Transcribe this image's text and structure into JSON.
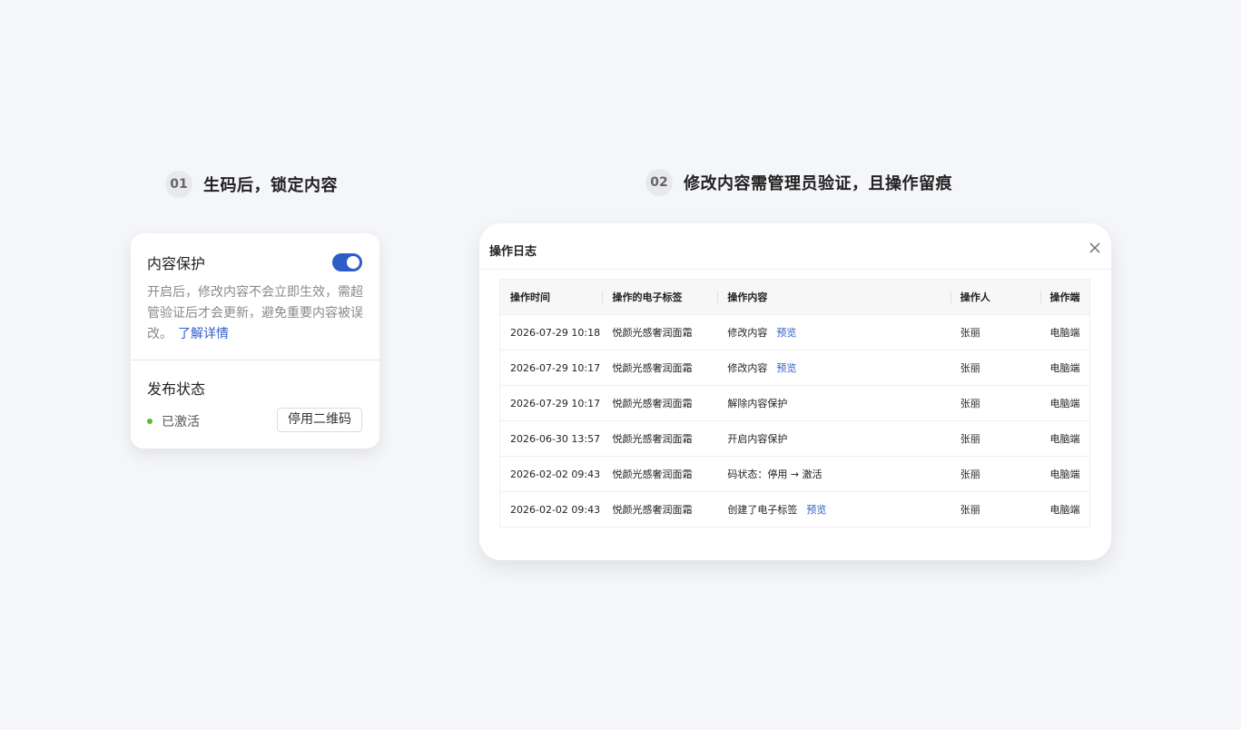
{
  "section1": {
    "number": "01",
    "title": "生码后，锁定内容"
  },
  "section2": {
    "number": "02",
    "title": "修改内容需管理员验证，且操作留痕"
  },
  "protection_card": {
    "title": "内容保护",
    "toggle_on": true,
    "description": "开启后，修改内容不会立即生效，需超管验证后才会更新，避免重要内容被误改。",
    "link": "了解详情",
    "status_label": "发布状态",
    "status_text": "已激活",
    "status_color": "#5bbd2c",
    "disable_button": "停用二维码",
    "accent_color": "#2f5cc8"
  },
  "log_dialog": {
    "title": "操作日志",
    "close_icon": "close-icon",
    "columns": [
      "操作时间",
      "操作的电子标签",
      "操作内容",
      "操作人",
      "操作端"
    ],
    "rows": [
      {
        "time": "2026-07-29 10:18",
        "tag": "悦颜光感奢润面霜",
        "content": "修改内容",
        "link": "预览",
        "operator": "张丽",
        "client": "电脑端"
      },
      {
        "time": "2026-07-29 10:17",
        "tag": "悦颜光感奢润面霜",
        "content": "修改内容",
        "link": "预览",
        "operator": "张丽",
        "client": "电脑端"
      },
      {
        "time": "2026-07-29 10:17",
        "tag": "悦颜光感奢润面霜",
        "content": "解除内容保护",
        "link": "",
        "operator": "张丽",
        "client": "电脑端"
      },
      {
        "time": "2026-06-30 13:57",
        "tag": "悦颜光感奢润面霜",
        "content": "开启内容保护",
        "link": "",
        "operator": "张丽",
        "client": "电脑端"
      },
      {
        "time": "2026-02-02 09:43",
        "tag": "悦颜光感奢润面霜",
        "content": "码状态：停用 → 激活",
        "link": "",
        "operator": "张丽",
        "client": "电脑端"
      },
      {
        "time": "2026-02-02 09:43",
        "tag": "悦颜光感奢润面霜",
        "content": "创建了电子标签",
        "link": "预览",
        "operator": "张丽",
        "client": "电脑端"
      }
    ]
  }
}
